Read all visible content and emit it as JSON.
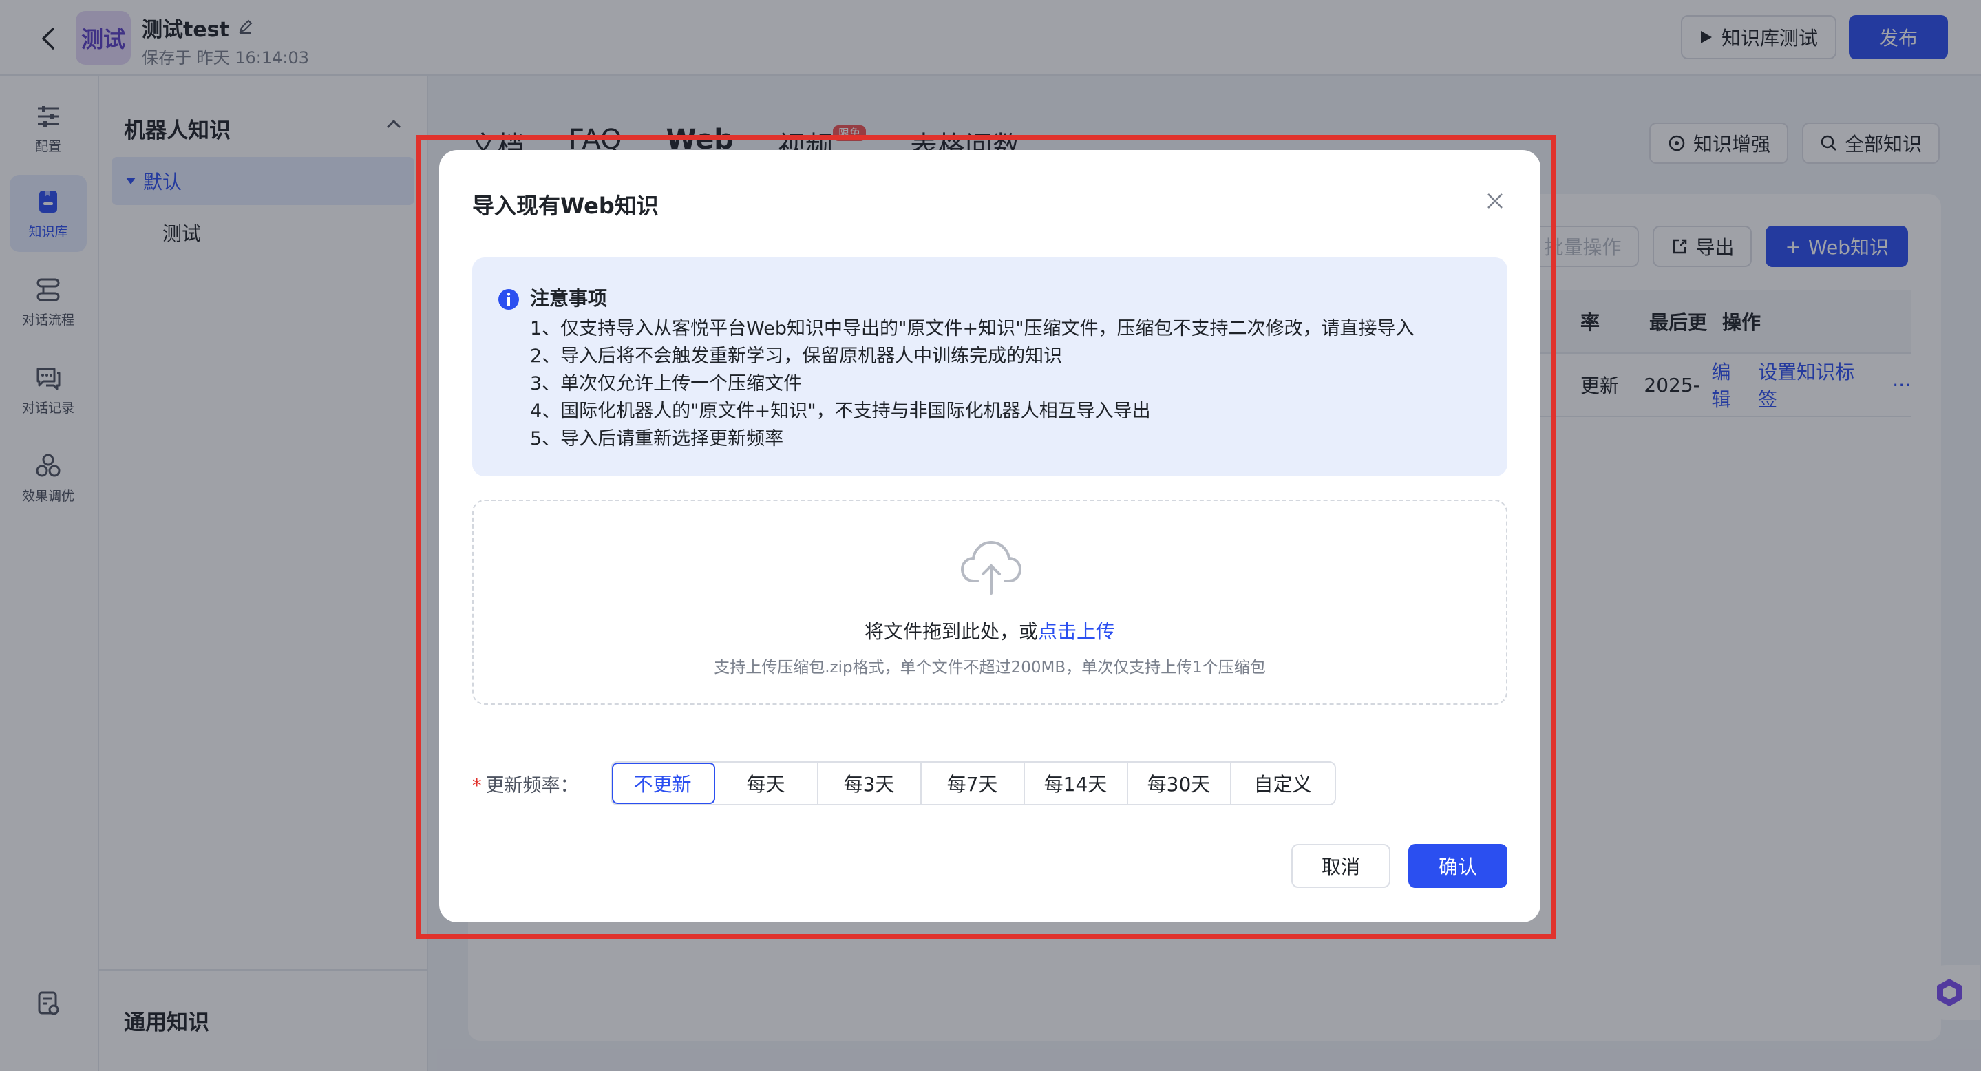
{
  "header": {
    "avatar_text": "测试",
    "title": "测试test",
    "saved": "保存于 昨天 16:14:03",
    "test_button": "知识库测试",
    "publish_button": "发布"
  },
  "leftnav": {
    "items": [
      {
        "label": "配置",
        "icon": "sliders-icon"
      },
      {
        "label": "知识库",
        "icon": "knowledge-icon"
      },
      {
        "label": "对话流程",
        "icon": "flow-icon"
      },
      {
        "label": "对话记录",
        "icon": "chat-record-icon"
      },
      {
        "label": "效果调优",
        "icon": "tuning-icon"
      }
    ]
  },
  "tree": {
    "title": "机器人知识",
    "default_node": "默认",
    "child_node": "测试",
    "general": "通用知识"
  },
  "main": {
    "tabs": [
      "文档",
      "FAQ",
      "Web",
      "视频",
      "表格问数"
    ],
    "tab_badge": "限免",
    "enhance_button": "知识增强",
    "all_button": "全部知识",
    "batch_button": "批量操作",
    "export_button": "导出",
    "add_button": "Web知识",
    "table_headers": [
      "率",
      "最后更",
      "操作"
    ],
    "row": {
      "freq": "更新",
      "date": "2025-",
      "edit": "编辑",
      "tag": "设置知识标签",
      "more": "···"
    }
  },
  "modal": {
    "title": "导入现有Web知识",
    "notice_title": "注意事项",
    "notice_items": [
      "1、仅支持导入从客悦平台Web知识中导出的\"原文件+知识\"压缩文件，压缩包不支持二次修改，请直接导入",
      "2、导入后将不会触发重新学习，保留原机器人中训练完成的知识",
      "3、单次仅允许上传一个压缩文件",
      "4、国际化机器人的\"原文件+知识\"，不支持与非国际化机器人相互导入导出",
      "5、导入后请重新选择更新频率"
    ],
    "upload_text": "将文件拖到此处，或",
    "upload_link": "点击上传",
    "upload_hint": "支持上传压缩包.zip格式，单个文件不超过200MB，单次仅支持上传1个压缩包",
    "freq_required": "*",
    "freq_label": "更新频率：",
    "freq_options": [
      "不更新",
      "每天",
      "每3天",
      "每7天",
      "每14天",
      "每30天",
      "自定义"
    ],
    "freq_selected": "不更新",
    "cancel": "取消",
    "confirm": "确认"
  },
  "colors": {
    "accent": "#2b4ff0",
    "highlight": "#e0322c",
    "notice_bg": "#e8eefc"
  }
}
